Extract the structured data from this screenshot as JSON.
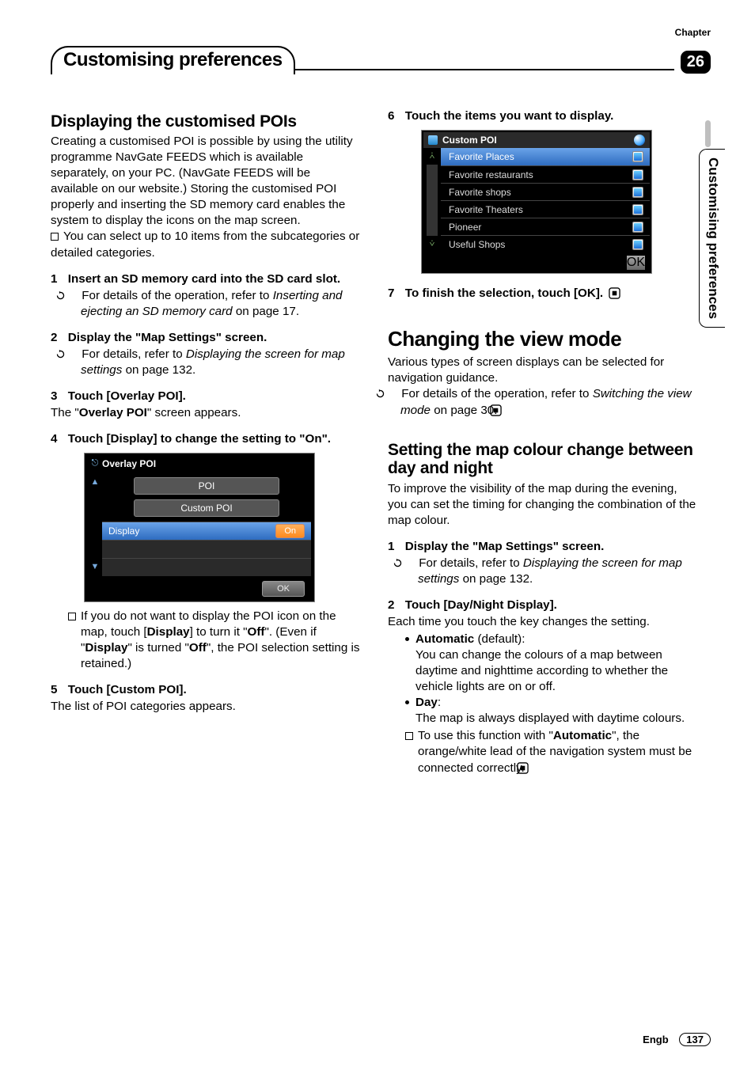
{
  "chapter_label": "Chapter",
  "chapter_number": "26",
  "chapter_title": "Customising preferences",
  "side_tab": "Customising preferences",
  "left": {
    "h2": "Displaying the customised POIs",
    "intro": "Creating a customised POI is possible by using the utility programme NavGate FEEDS which is available separately, on your PC. (NavGate FEEDS will be available on our website.) Storing the customised POI properly and inserting the SD memory card enables the system to display the icons on the map screen.",
    "note1": "You can select up to 10 items from the subcategories or detailed categories.",
    "step1_num": "1",
    "step1": "Insert an SD memory card into the SD card slot.",
    "ref1a": "For details of the operation, refer to ",
    "ref1b": "Inserting and ejecting an SD memory card",
    "ref1c": " on page 17.",
    "step2_num": "2",
    "step2": "Display the \"Map Settings\" screen.",
    "ref2a": "For details, refer to ",
    "ref2b": "Displaying the screen for map settings",
    "ref2c": " on page 132.",
    "step3_num": "3",
    "step3": "Touch [Overlay POI].",
    "step3_body_a": "The \"",
    "step3_body_b": "Overlay POI",
    "step3_body_c": "\" screen appears.",
    "step4_num": "4",
    "step4": "Touch [Display] to change the setting to \"On\".",
    "shotA": {
      "title": "Overlay POI",
      "btn_poi": "POI",
      "btn_custom": "Custom POI",
      "row_display": "Display",
      "row_on": "On",
      "ok": "OK"
    },
    "note2a": "If you do not want to display the POI icon on the map, touch [",
    "note2b": "Display",
    "note2c": "] to turn it \"",
    "note2d": "Off",
    "note2e": "\". (Even if \"",
    "note2f": "Display",
    "note2g": "\" is turned \"",
    "note2h": "Off",
    "note2i": "\", the POI selection setting is retained.)",
    "step5_num": "5",
    "step5": "Touch [Custom POI].",
    "step5_body": "The list of POI categories appears."
  },
  "right": {
    "step6_num": "6",
    "step6": "Touch the items you want to display.",
    "shotB": {
      "title": "Custom POI",
      "items": [
        "Favorite Places",
        "Favorite restaurants",
        "Favorite shops",
        "Favorite Theaters",
        "Pioneer",
        "Useful Shops"
      ],
      "ok": "OK"
    },
    "step7_num": "7",
    "step7": "To finish the selection, touch [OK].",
    "h1": "Changing the view mode",
    "h1_body": "Various types of screen displays can be selected for navigation guidance.",
    "h1_refa": "For details of the operation, refer to ",
    "h1_refb": "Switching the view mode",
    "h1_refc": " on page 30.",
    "h2": "Setting the map colour change between day and night",
    "h2_body": "To improve the visibility of the map during the evening, you can set the timing for changing the combination of the map colour.",
    "r_step1_num": "1",
    "r_step1": "Display the \"Map Settings\" screen.",
    "r_ref1a": "For details, refer to ",
    "r_ref1b": "Displaying the screen for map settings",
    "r_ref1c": " on page 132.",
    "r_step2_num": "2",
    "r_step2": "Touch [Day/Night Display].",
    "r_step2_body": "Each time you touch the key changes the setting.",
    "auto_label": "Automatic",
    "auto_suffix": " (default):",
    "auto_body": "You can change the colours of a map between daytime and nighttime according to whether the vehicle lights are on or off.",
    "day_label": "Day",
    "day_suffix": ":",
    "day_body": "The map is always displayed with daytime colours.",
    "tail_a": "To use this function with \"",
    "tail_b": "Automatic",
    "tail_c": "\", the orange/white lead of the navigation system must be connected correctly."
  },
  "footer": {
    "lang": "Engb",
    "page": "137"
  }
}
